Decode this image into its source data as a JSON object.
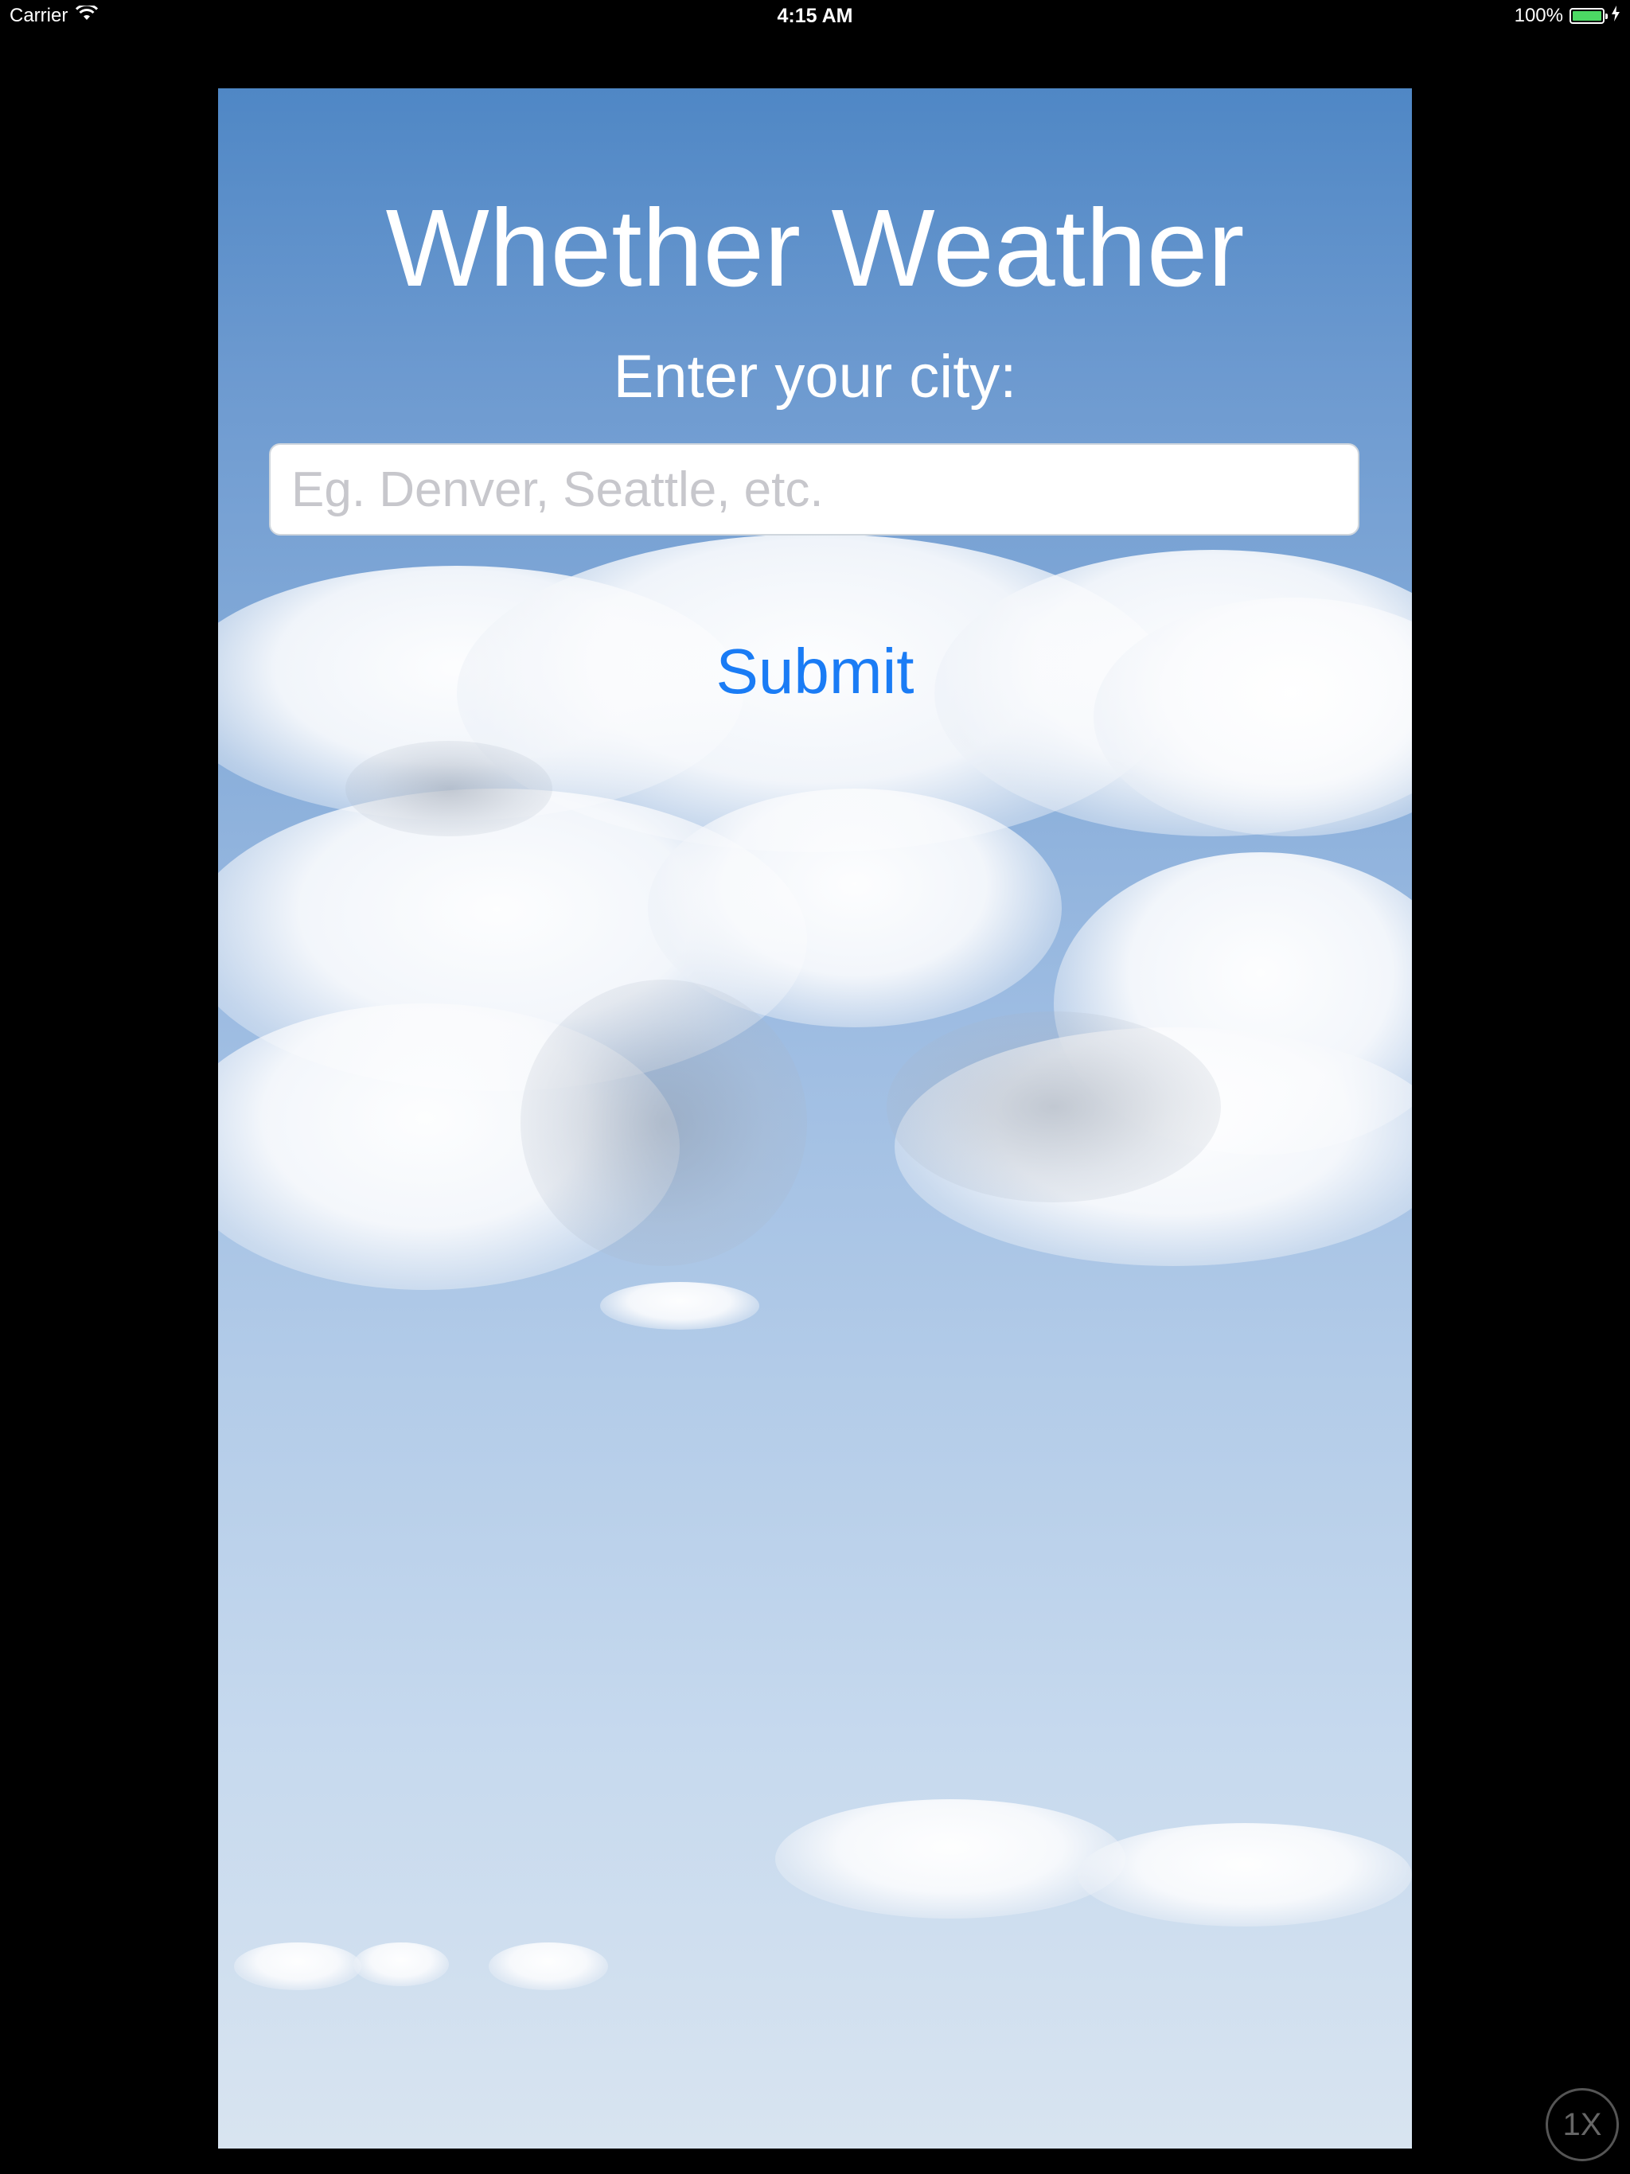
{
  "status_bar": {
    "carrier": "Carrier",
    "time": "4:15 AM",
    "battery_percent": "100%",
    "battery_level": 1.0,
    "wifi_icon": "wifi-icon",
    "charging_icon": "bolt-icon"
  },
  "app": {
    "title": "Whether Weather",
    "prompt": "Enter your city:",
    "city_input": {
      "value": "",
      "placeholder": "Eg. Denver, Seattle, etc."
    },
    "submit_label": "Submit"
  },
  "simulator": {
    "scale_label": "1X"
  },
  "colors": {
    "accent": "#1a7cf5",
    "battery": "#4cd964",
    "background": "#000000"
  }
}
